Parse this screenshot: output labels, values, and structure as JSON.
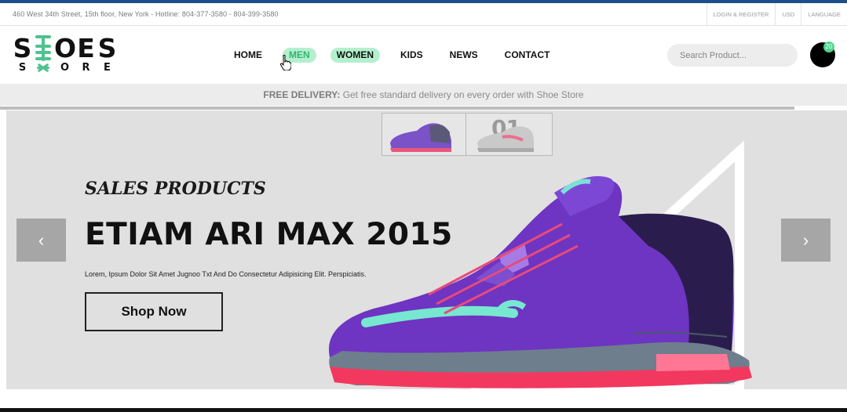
{
  "topbar": {
    "address": "460 West 34th Street, 15th floor, New York - Hotline: 804-377-3580 - 804-399-3580",
    "links": [
      "LOGIN & REGISTER",
      "USD",
      "LANGUAGE"
    ]
  },
  "logo": {
    "row1": [
      "S",
      "E",
      "O",
      "E",
      "S"
    ],
    "row2": [
      "S",
      "O",
      "R",
      "E"
    ]
  },
  "nav": {
    "items": [
      "HOME",
      "MEN",
      "WOMEN",
      "KIDS",
      "NEWS",
      "CONTACT"
    ],
    "active": "WOMEN"
  },
  "search": {
    "placeholder": "Search Product..."
  },
  "cart": {
    "count": "20"
  },
  "delivery": {
    "label": "FREE DELIVERY:",
    "text": "Get free standard delivery on every order with Shoe Store"
  },
  "hero": {
    "thumbnail_number": "01",
    "subtitle": "SALES PRODUCTS",
    "title": "ETIAM ARI MAX 2015",
    "description": "Lorem, Ipsum Dolor Sit Amet Jugnoo Txt And Do Consectetur Adipisicing Elit. Perspiciatis.",
    "cta": "Shop Now",
    "prev_icon": "‹",
    "next_icon": "›"
  },
  "colors": {
    "accent_green": "#4fc28f",
    "active_pill": "#b3f0cd",
    "top_accent": "#1f4f8b",
    "shoe_purple": "#6b2fbf",
    "sole_red": "#f2385f"
  }
}
